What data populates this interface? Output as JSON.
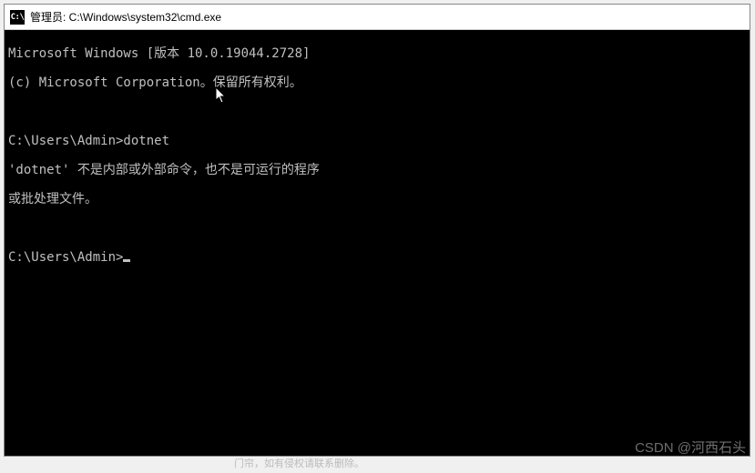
{
  "window": {
    "icon_text": "C:\\",
    "title": "管理员: C:\\Windows\\system32\\cmd.exe"
  },
  "terminal": {
    "line1": "Microsoft Windows [版本 10.0.19044.2728]",
    "line2": "(c) Microsoft Corporation。保留所有权利。",
    "line3": "",
    "line4": "C:\\Users\\Admin>dotnet",
    "line5": "'dotnet' 不是内部或外部命令，也不是可运行的程序",
    "line6": "或批处理文件。",
    "line7": "",
    "line8_prompt": "C:\\Users\\Admin>"
  },
  "watermark": "CSDN @河西石头",
  "footer_fragment": "门帘，如有侵权请联系删除。"
}
